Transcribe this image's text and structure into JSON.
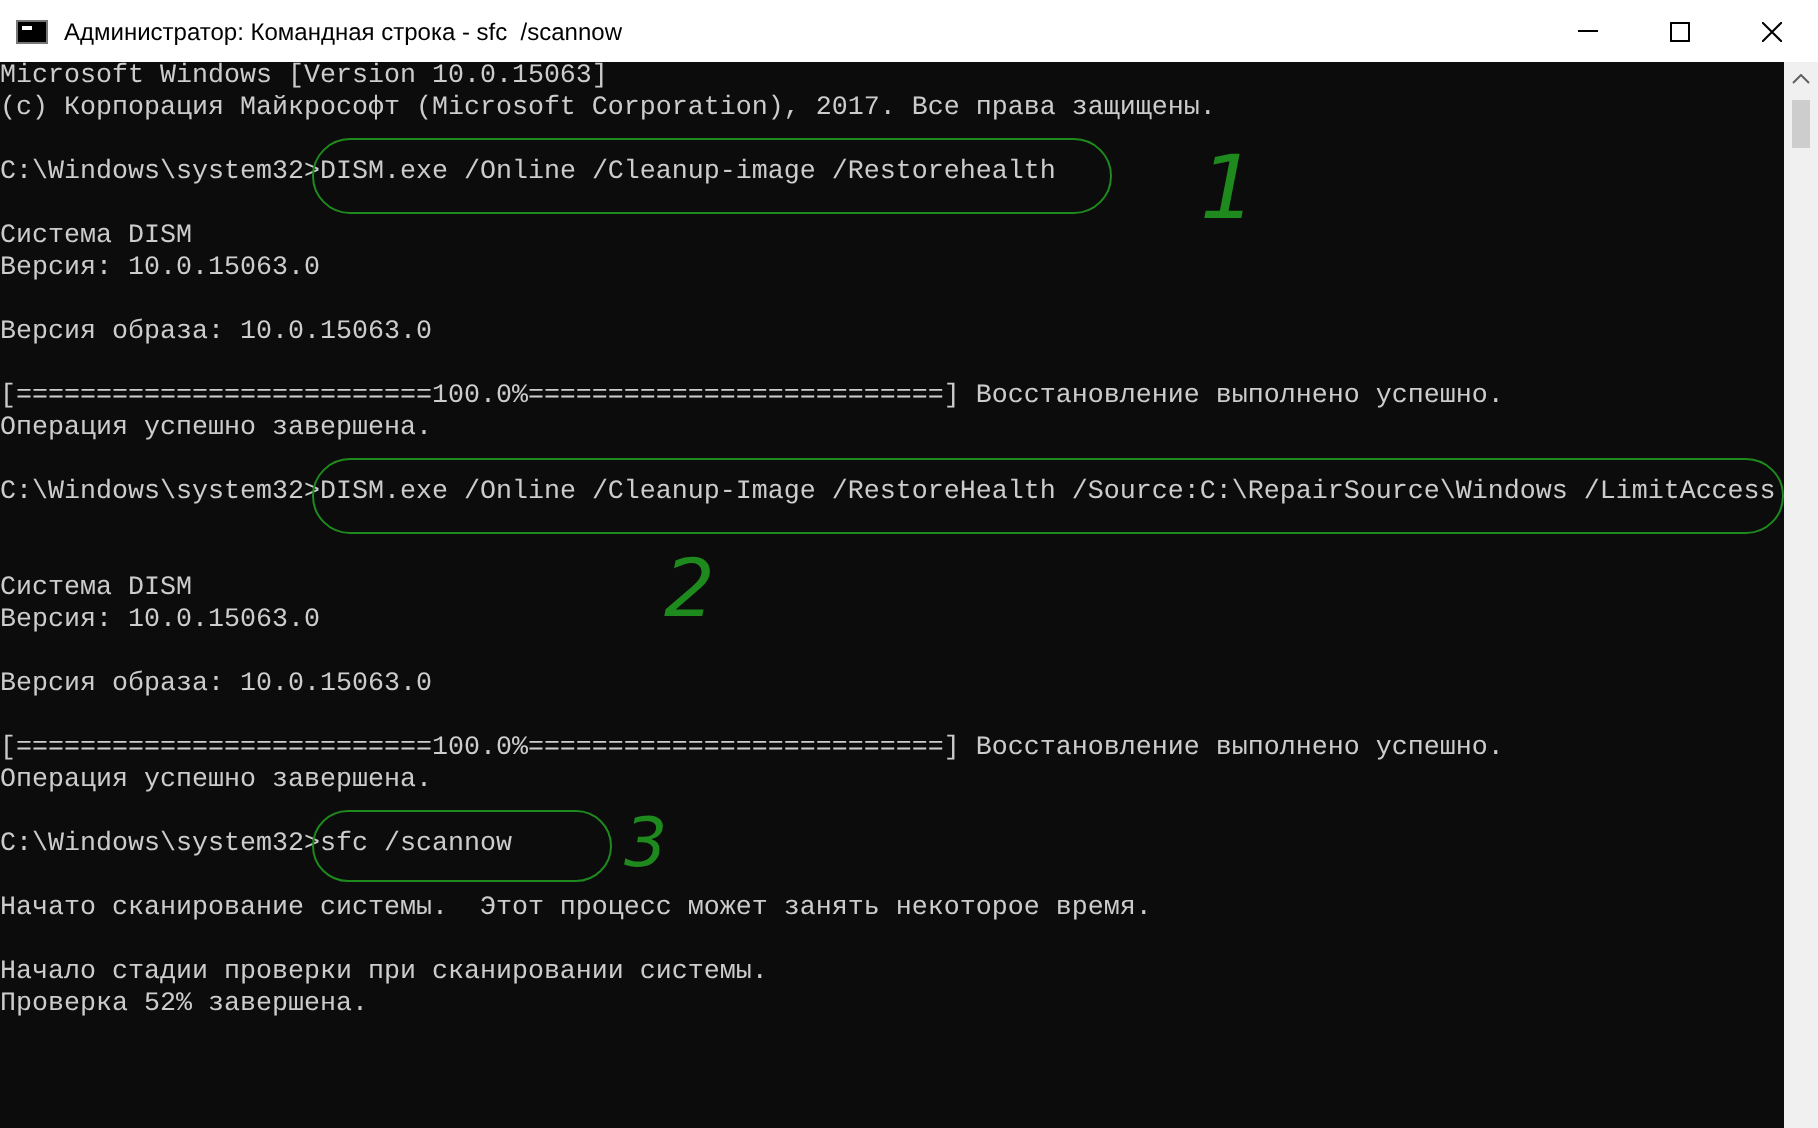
{
  "window": {
    "title": "Администратор: Командная строка - sfc  /scannow"
  },
  "lines": [
    {
      "kind": "text",
      "text": "Microsoft Windows [Version 10.0.15063]"
    },
    {
      "kind": "text",
      "text": "(c) Корпорация Майкрософт (Microsoft Corporation), 2017. Все права защищены."
    },
    {
      "kind": "blank"
    },
    {
      "kind": "command",
      "prompt": "C:\\Windows\\system32>",
      "command": "DISM.exe /Online /Cleanup-image /Restorehealth",
      "annotation": "1"
    },
    {
      "kind": "blank"
    },
    {
      "kind": "text",
      "text": "Система DISM"
    },
    {
      "kind": "text",
      "text": "Версия: 10.0.15063.0"
    },
    {
      "kind": "blank"
    },
    {
      "kind": "text",
      "text": "Версия образа: 10.0.15063.0"
    },
    {
      "kind": "blank"
    },
    {
      "kind": "text",
      "text": "[==========================100.0%==========================] Восстановление выполнено успешно."
    },
    {
      "kind": "text",
      "text": "Операция успешно завершена."
    },
    {
      "kind": "blank"
    },
    {
      "kind": "command",
      "prompt": "C:\\Windows\\system32>",
      "command": "DISM.exe /Online /Cleanup-Image /RestoreHealth /Source:C:\\RepairSource\\Windows /LimitAccess",
      "annotation": "2"
    },
    {
      "kind": "blank"
    },
    {
      "kind": "blank"
    },
    {
      "kind": "text",
      "text": "Система DISM"
    },
    {
      "kind": "text",
      "text": "Версия: 10.0.15063.0"
    },
    {
      "kind": "blank"
    },
    {
      "kind": "text",
      "text": "Версия образа: 10.0.15063.0"
    },
    {
      "kind": "blank"
    },
    {
      "kind": "text",
      "text": "[==========================100.0%==========================] Восстановление выполнено успешно."
    },
    {
      "kind": "text",
      "text": "Операция успешно завершена."
    },
    {
      "kind": "blank"
    },
    {
      "kind": "command",
      "prompt": "C:\\Windows\\system32>",
      "command": "sfc /scannow",
      "annotation": "3"
    },
    {
      "kind": "blank"
    },
    {
      "kind": "text",
      "text": "Начато сканирование системы.  Этот процесс может занять некоторое время."
    },
    {
      "kind": "blank"
    },
    {
      "kind": "text",
      "text": "Начало стадии проверки при сканировании системы."
    },
    {
      "kind": "text",
      "text": "Проверка 52% завершена."
    }
  ]
}
